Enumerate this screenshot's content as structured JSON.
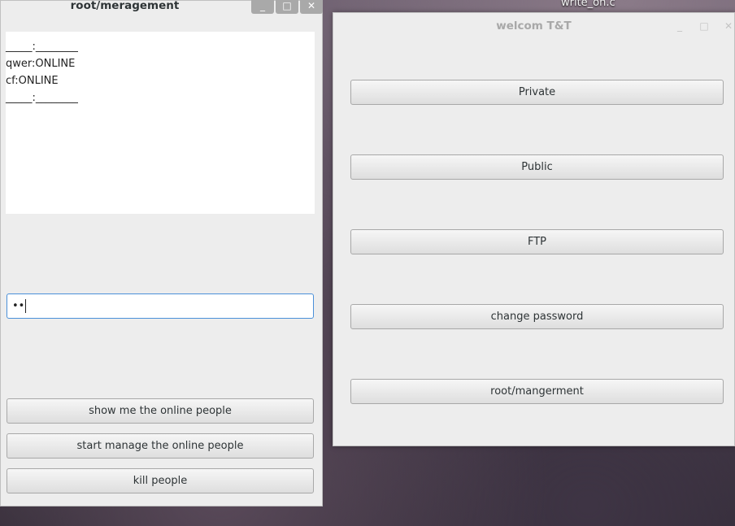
{
  "desktop": {
    "label": "write_on.c"
  },
  "manage_window": {
    "title": "root/meragement",
    "controls": {
      "minimize": "_",
      "maximize": "□",
      "close": "✕"
    },
    "output_lines": [
      "_____:________",
      "qwer:ONLINE",
      "cf:ONLINE",
      "_____:________"
    ],
    "password_entry": {
      "value": "••"
    },
    "buttons": {
      "show": "show me the online people",
      "manage": "start manage the online people",
      "kill": "kill people"
    }
  },
  "welcome_window": {
    "title": "welcom T&T",
    "controls": {
      "minimize": "_",
      "maximize": "□",
      "close": "✕"
    },
    "buttons": {
      "private": "Private",
      "public": "Public",
      "ftp": "FTP",
      "change_password": "change password",
      "root": "root/mangerment"
    }
  }
}
